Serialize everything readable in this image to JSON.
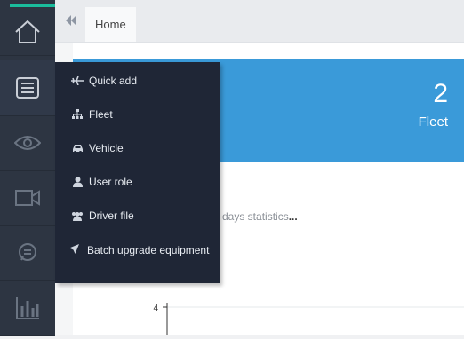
{
  "colors": {
    "rail": "#2d3542",
    "accent": "#1abc9c",
    "menu": "#1f2636",
    "card": "#3a9ad9"
  },
  "rail": {
    "items": [
      {
        "icon": "home-icon"
      },
      {
        "icon": "list-icon"
      },
      {
        "icon": "eye-icon"
      },
      {
        "icon": "video-icon"
      },
      {
        "icon": "chat-icon"
      },
      {
        "icon": "bar-chart-icon"
      }
    ]
  },
  "tabbar": {
    "collapse_icon": "double-chevron-left-icon",
    "tabs": [
      {
        "label": "Home"
      }
    ]
  },
  "menu": {
    "items": [
      {
        "label": "Quick add",
        "icon": "plane-icon"
      },
      {
        "label": "Fleet",
        "icon": "sitemap-icon"
      },
      {
        "label": "Vehicle",
        "icon": "car-icon"
      },
      {
        "label": "User role",
        "icon": "user-icon"
      },
      {
        "label": "Driver file",
        "icon": "users-icon"
      },
      {
        "label": "Batch upgrade equipment",
        "icon": "send-icon"
      }
    ]
  },
  "stat_card": {
    "value": "2",
    "label": "Fleet"
  },
  "stats": {
    "title": "days statistics",
    "ellipsis": "..."
  },
  "chart_data": {
    "type": "line",
    "yticks": [
      4
    ],
    "title": "",
    "xlabel": "",
    "ylabel": ""
  }
}
